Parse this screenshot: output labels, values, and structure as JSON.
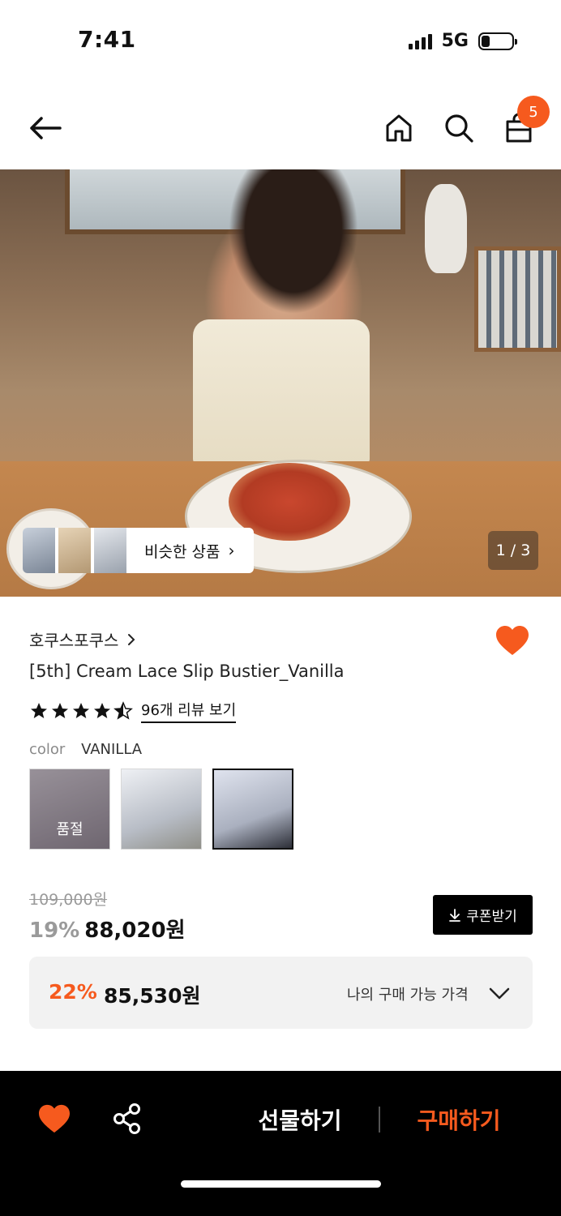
{
  "status_bar": {
    "time": "7:41",
    "network": "5G"
  },
  "nav": {
    "cart_count": "5"
  },
  "hero": {
    "similar_label": "비슷한 상품",
    "page_indicator": "1 / 3"
  },
  "product": {
    "brand": "호쿠스포쿠스",
    "name": "[5th] Cream Lace Slip Bustier_Vanilla",
    "rating": 4.5,
    "review_link": "96개 리뷰 보기",
    "color_key": "color",
    "color_value": "VANILLA",
    "swatches": [
      {
        "soldout_label": "품절"
      },
      {},
      {}
    ]
  },
  "price": {
    "original": "109,000원",
    "discount": "19%",
    "sale": "88,020원",
    "coupon_label": "쿠폰받기",
    "my_discount": "22%",
    "my_price": "85,530원",
    "my_label": "나의 구매 가능 가격"
  },
  "bottom_bar": {
    "gift_label": "선물하기",
    "buy_label": "구매하기"
  },
  "colors": {
    "accent": "#f65a1e",
    "dark": "#000000"
  },
  "icons": [
    "back-arrow-icon",
    "home-icon",
    "search-icon",
    "shopping-bag-icon",
    "heart-icon",
    "share-icon",
    "download-icon",
    "chevron-down-icon",
    "chevron-right-icon",
    "star-icon"
  ]
}
